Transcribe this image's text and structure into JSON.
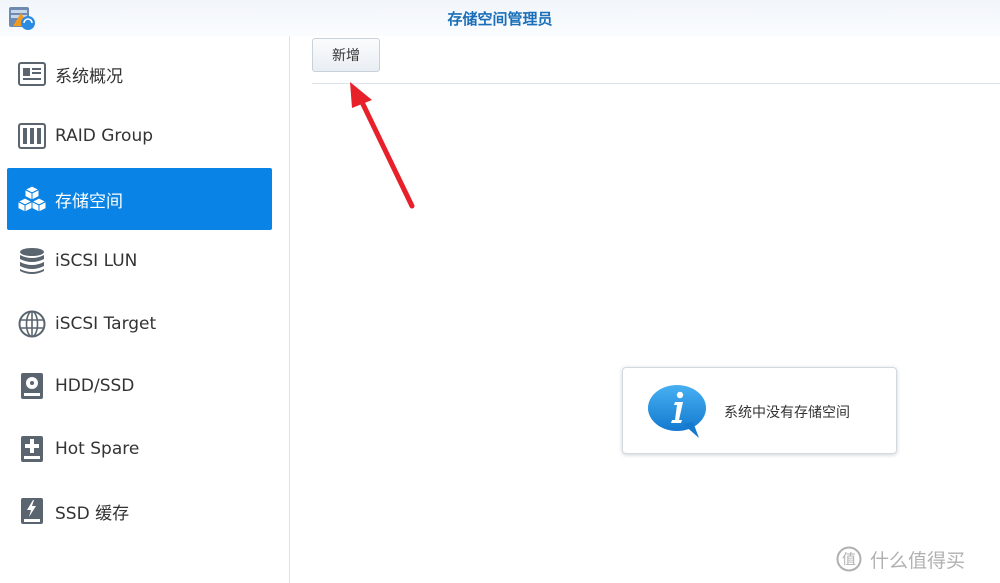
{
  "window": {
    "title": "存储空间管理员",
    "app_icon": "storage-manager-app-icon"
  },
  "sidebar": {
    "items": [
      {
        "label": "系统概况",
        "icon": "overview-icon",
        "active": false
      },
      {
        "label": "RAID Group",
        "icon": "raid-group-icon",
        "active": false
      },
      {
        "label": "存储空间",
        "icon": "storage-cubes-icon",
        "active": true
      },
      {
        "label": "iSCSI LUN",
        "icon": "database-icon",
        "active": false
      },
      {
        "label": "iSCSI Target",
        "icon": "globe-icon",
        "active": false
      },
      {
        "label": "HDD/SSD",
        "icon": "hard-disk-icon",
        "active": false
      },
      {
        "label": "Hot Spare",
        "icon": "hot-spare-icon",
        "active": false
      },
      {
        "label": "SSD 缓存",
        "icon": "ssd-cache-icon",
        "active": false
      }
    ]
  },
  "toolbar": {
    "add_label": "新增"
  },
  "info": {
    "message": "系统中没有存储空间",
    "icon": "info-bubble-icon"
  },
  "watermark": {
    "text": "什么值得买",
    "icon": "zhi-logo-icon"
  },
  "colors": {
    "accent": "#0a83e6",
    "title": "#1a6fb8",
    "arrow": "#e8202a",
    "info_icon": "#1e8fe0"
  }
}
